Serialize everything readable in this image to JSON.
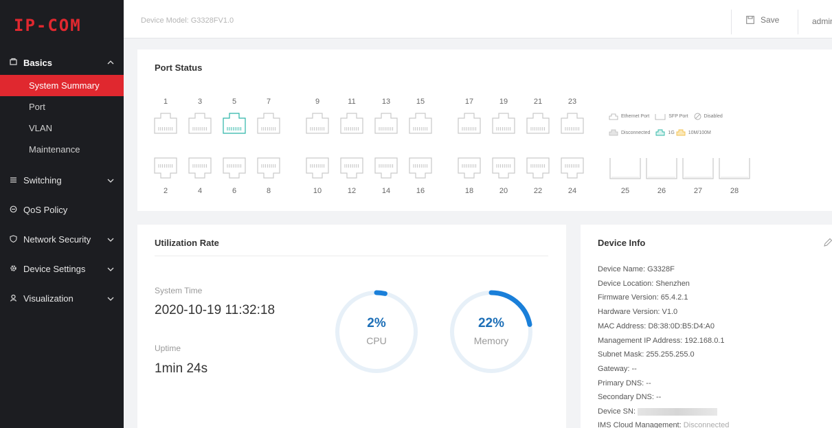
{
  "brand": {
    "logo": "IP-COM",
    "accent": "#e0282f"
  },
  "topbar": {
    "device_model": "Device Model: G3328FV1.0",
    "save_label": "Save",
    "user_label": "admin"
  },
  "sidebar": {
    "groups": [
      {
        "icon": "basics-icon",
        "label": "Basics",
        "expanded": true,
        "items": [
          {
            "label": "System Summary",
            "active": true
          },
          {
            "label": "Port"
          },
          {
            "label": "VLAN"
          },
          {
            "label": "Maintenance"
          }
        ]
      },
      {
        "icon": "switching-icon",
        "label": "Switching",
        "expanded": false
      },
      {
        "icon": "qos-icon",
        "label": "QoS Policy",
        "expanded": false
      },
      {
        "icon": "shield-icon",
        "label": "Network Security",
        "expanded": false
      },
      {
        "icon": "gear-icon",
        "label": "Device Settings",
        "expanded": false
      },
      {
        "icon": "visualization-icon",
        "label": "Visualization",
        "expanded": false
      }
    ]
  },
  "port_status": {
    "title": "Port Status",
    "top_ports": [
      "1",
      "3",
      "5",
      "7",
      "9",
      "11",
      "13",
      "15",
      "17",
      "19",
      "21",
      "23"
    ],
    "bottom_ports": [
      "2",
      "4",
      "6",
      "8",
      "10",
      "12",
      "14",
      "16",
      "18",
      "20",
      "22",
      "24"
    ],
    "sfp_ports": [
      "25",
      "26",
      "27",
      "28"
    ],
    "states": {
      "5": "1G"
    },
    "legend": {
      "ethernet": "Ethernet Port",
      "sfp": "SFP Port",
      "disabled": "Disabled",
      "disconnected": "Disconnected",
      "g1": "1G",
      "m10_100": "10M/100M"
    },
    "colors": {
      "1G": "#2ab5a6",
      "10M/100M": "#f3c04d",
      "disconnected": "#bdbdbd"
    }
  },
  "utilization": {
    "title": "Utilization Rate",
    "system_time_label": "System Time",
    "system_time": "2020-10-19 11:32:18",
    "uptime_label": "Uptime",
    "uptime": "1min 24s",
    "cpu": {
      "value": "2%",
      "label": "CPU",
      "fraction": 0.02
    },
    "memory": {
      "value": "22%",
      "label": "Memory",
      "fraction": 0.22
    }
  },
  "device_info": {
    "title": "Device Info",
    "rows": [
      "Device Name: G3328F",
      "Device Location: Shenzhen",
      "Firmware Version: 65.4.2.1",
      "Hardware Version: V1.0",
      "MAC Address: D8:38:0D:B5:D4:A0",
      "Management IP Address: 192.168.0.1",
      "Subnet Mask: 255.255.255.0",
      "Gateway: --",
      "Primary DNS: --",
      "Secondary DNS: --"
    ],
    "sn_label": "Device SN:",
    "cloud_label": "IMS Cloud Management:",
    "cloud_status": "Disconnected"
  }
}
